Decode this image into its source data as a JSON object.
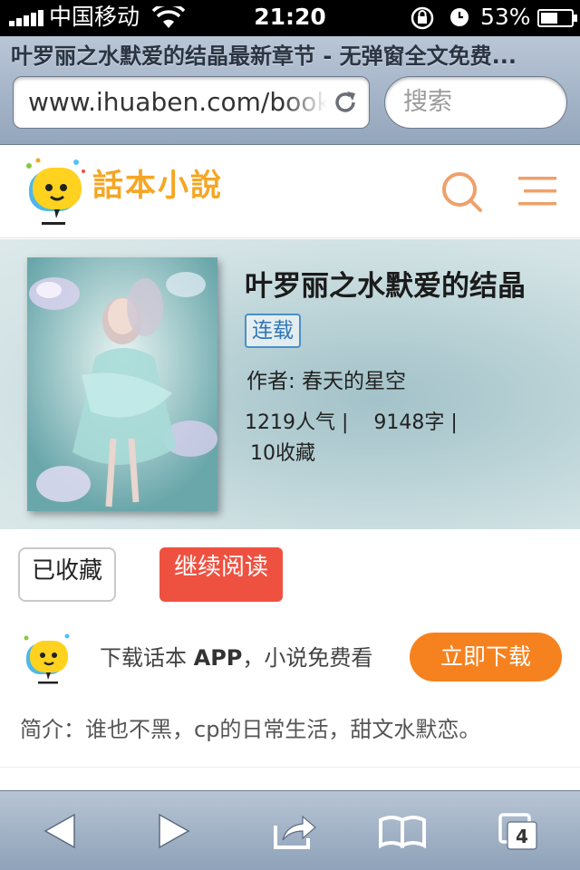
{
  "status_bar": {
    "carrier": "中国移动",
    "time": "21:20",
    "battery": "53%"
  },
  "browser": {
    "page_title": "叶罗丽之水默爱的结晶最新章节 - 无弹窗全文免费...",
    "url": "www.ihuaben.com/book/",
    "search_placeholder": "搜索"
  },
  "site": {
    "logo_text": "話本小說"
  },
  "book": {
    "title": "叶罗丽之水默爱的结晶",
    "status": "连载",
    "author": "作者: 春天的星空",
    "stats_line1": "1219人气 |    9148字 |",
    "stats_line2": "10收藏"
  },
  "actions": {
    "favorite_label": "已收藏",
    "read_label": "继续阅读"
  },
  "promo": {
    "text_prefix": "下载话本 ",
    "text_app": "APP",
    "text_suffix": "，小说免费看",
    "download_label": "立即下载"
  },
  "intro": "简介：谁也不黑，cp的日常生活，甜文水默恋。",
  "toolbar": {
    "tabs_count": "4"
  },
  "colors": {
    "accent_red": "#ef5140",
    "accent_orange": "#f5821f",
    "badge_blue": "#4a90c9",
    "logo_yellow": "#f5a623"
  }
}
